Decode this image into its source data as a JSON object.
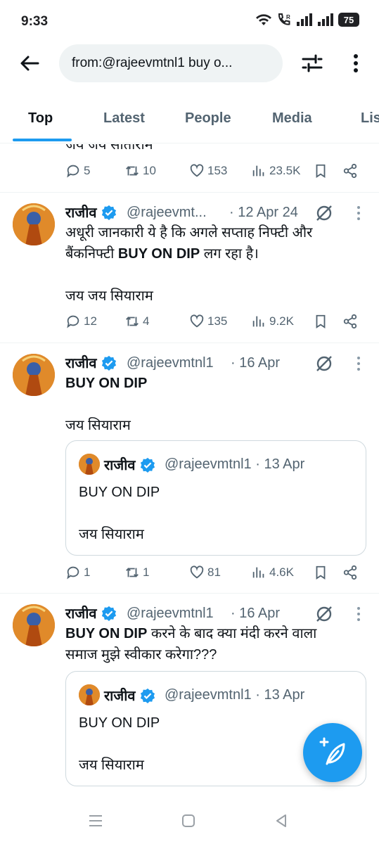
{
  "status": {
    "time": "9:33",
    "battery": "75"
  },
  "search": {
    "query": "from:@rajeevmtnl1 buy o..."
  },
  "tabs": [
    "Top",
    "Latest",
    "People",
    "Media",
    "Lis"
  ],
  "partial": {
    "text": "जय जय सीताराम",
    "replies": "5",
    "reposts": "10",
    "likes": "153",
    "views": "23.5K"
  },
  "tweets": [
    {
      "name": "राजीव",
      "handle": "@rajeevmt...",
      "date": "· 12 Apr 24",
      "line1": "अधूरी जानकारी ये है कि अगले सप्ताह निफ्टी और",
      "line2_pre": "बैंकनिफ्टी ",
      "line2_bold": "BUY ON DIP",
      "line2_post": " लग रहा है।",
      "line3": "जय जय सियाराम",
      "replies": "12",
      "reposts": "4",
      "likes": "135",
      "views": "9.2K"
    },
    {
      "name": "राजीव",
      "handle": "@rajeevmtnl1",
      "date": "· 16 Apr",
      "line1": "BUY ON DIP",
      "line3": "जय सियाराम",
      "quote": {
        "name": "राजीव",
        "handle": "@rajeevmtnl1 · 13 Apr",
        "line1": "BUY ON DIP",
        "line2": "जय सियाराम"
      },
      "replies": "1",
      "reposts": "1",
      "likes": "81",
      "views": "4.6K"
    },
    {
      "name": "राजीव",
      "handle": "@rajeevmtnl1",
      "date": "· 16 Apr",
      "line1_bold": "BUY ON DIP",
      "line1_post": " करने के बाद क्या मंदी करने वाला",
      "line2": "समाज मुझे स्वीकार करेगा???",
      "quote": {
        "name": "राजीव",
        "handle": "@rajeevmtnl1 · 13 Apr",
        "line1": "BUY ON DIP",
        "line2": "जय सियाराम"
      }
    }
  ],
  "colors": {
    "accent": "#1d9bf0",
    "text": "#0f1419",
    "muted": "#536471"
  }
}
